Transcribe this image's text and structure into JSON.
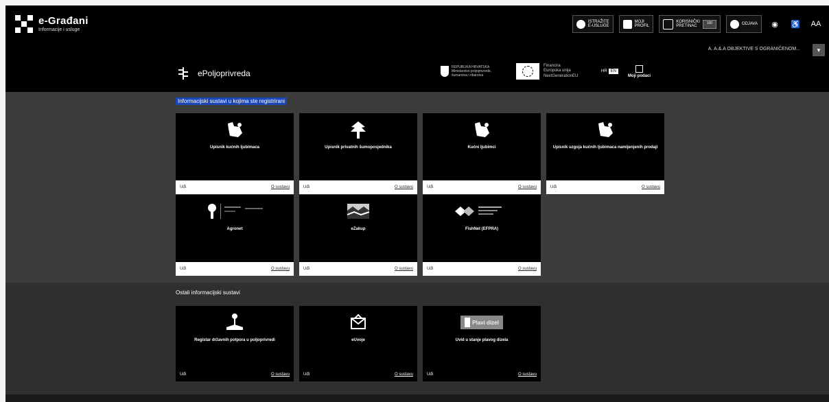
{
  "topbar": {
    "logo_title": "e-Građani",
    "logo_subtitle": "Informacije i usluge",
    "buttons": [
      {
        "label": "ISTRAŽITE\nE-USLUGE",
        "icon": "globe-icon"
      },
      {
        "label": "MOJI\nPROFIL",
        "icon": "profile-icon"
      },
      {
        "label": "KORISNIČKI\nPRETINAC",
        "icon": "inbox-icon",
        "badge": "100"
      },
      {
        "label": "ODJAVA",
        "icon": "logout-icon"
      }
    ],
    "icons": [
      "eye-icon",
      "accessibility-icon"
    ],
    "text_size_label": "AA"
  },
  "subbar": {
    "user_text": "A. A.&.A OBJEKTIVE S OGRANIČENOM..."
  },
  "header": {
    "app_name": "ePoljoprivreda",
    "ministry": "REPUBLIKA HRVATSKA\nMinistarstvo poljoprivrede,\nšumarstva i ribarstva",
    "eu_text": "Financira\nEuropska unija\nNextGenerationEU",
    "lang_hr": "HR",
    "lang_en": "EN",
    "my_data": "Moji podaci"
  },
  "section_registered": {
    "title": "Informacijski sustavi u kojima ste registrirani",
    "cards": [
      {
        "title": "Upisnik kućnih ljubimaca",
        "icon": "dog-icon",
        "view": "Uđi",
        "more": "O sustavu"
      },
      {
        "title": "Upisnik privatnih šumoposjednika",
        "icon": "tree-icon",
        "view": "Uđi",
        "more": "O sustavu"
      },
      {
        "title": "Kućni ljubimci",
        "icon": "dog-icon",
        "view": "Uđi",
        "more": "O sustavu"
      },
      {
        "title": "Upisnik uzgoja kućnih ljubimaca namijenjenih prodaji",
        "icon": "dog-icon",
        "view": "Uđi",
        "more": "O sustavu"
      },
      {
        "title": "Agronet",
        "icon": "agronet-icon",
        "view": "Uđi",
        "more": "O sustavu"
      },
      {
        "title": "eZakup",
        "icon": "landscape-icon",
        "view": "Uđi",
        "more": "O sustavu"
      },
      {
        "title": "FishNet (EFPRA)",
        "icon": "fish-icon",
        "view": "Uđi",
        "more": "O sustavu"
      }
    ]
  },
  "section_other": {
    "title": "Ostali informacijski sustavi",
    "cards": [
      {
        "title": "Registar državnih potpora u poljoprivredi",
        "icon": "plant-icon",
        "view": "Uđi",
        "more": "O sustavu"
      },
      {
        "title": "eUvoje",
        "icon": "mail-icon",
        "view": "Uđi",
        "more": "O sustavu"
      },
      {
        "title": "Uvid u stanje plavog dizela",
        "icon": "fuel-icon",
        "view": "Uđi",
        "more": "O sustavu",
        "badge": "Plavi dizel"
      }
    ]
  },
  "colors": {
    "page_bg": "#f3f3f3",
    "topbar_bg": "#000000",
    "section1_bg": "#3c3c3c",
    "section2_bg": "#2f2f2f",
    "accent_title_bg": "#1a46b8"
  }
}
